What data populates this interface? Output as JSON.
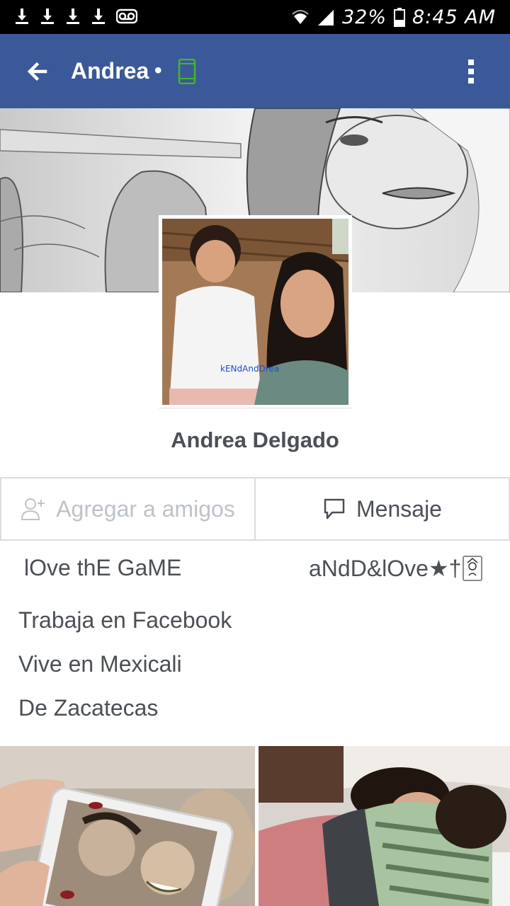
{
  "status_bar": {
    "battery": "32%",
    "time": "8:45 AM",
    "icons": [
      "download-icon",
      "download-icon",
      "download-icon",
      "download-icon",
      "voicemail-icon",
      "wifi-icon",
      "signal-icon",
      "battery-icon"
    ]
  },
  "app_bar": {
    "title": "Andrea",
    "dot": "•",
    "status_icon": "mobile-icon",
    "status_color": "#42b72a",
    "bg_color": "#3b5998"
  },
  "profile": {
    "name": "Andrea Delgado",
    "photo_caption": "kENdAndDrea"
  },
  "actions": {
    "add_friend": "Agregar a amigos",
    "message": "Mensaje"
  },
  "intro": {
    "bio_left": "lOve thE GaME",
    "bio_right": "aNdD&lOve★†",
    "bio_icon": "joker-card-icon",
    "work": "Trabaja en Facebook",
    "lives": "Vive en Mexicali",
    "from": "De Zacatecas"
  }
}
